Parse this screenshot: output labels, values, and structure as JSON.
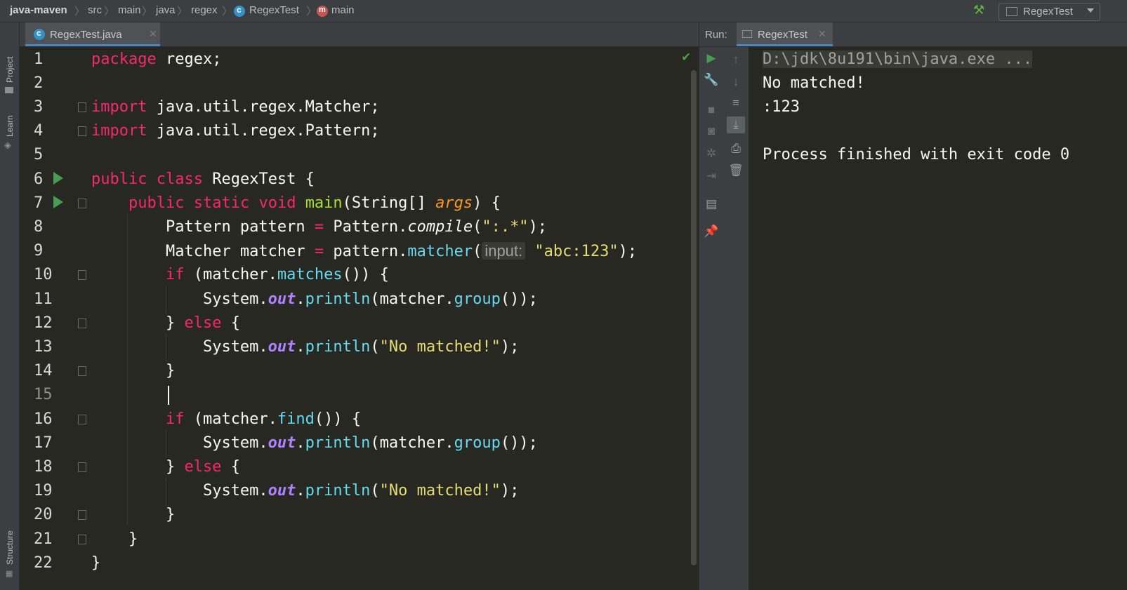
{
  "breadcrumb": {
    "project": "java-maven",
    "items": [
      "src",
      "main",
      "java",
      "regex",
      "RegexTest",
      "main"
    ]
  },
  "run_config": {
    "label": "RegexTest"
  },
  "left_strip": {
    "project_label": "Project",
    "learn_label": "Learn",
    "structure_label": "Structure"
  },
  "editor": {
    "tab_label": "RegexTest.java",
    "line_numbers": [
      "1",
      "2",
      "3",
      "4",
      "5",
      "6",
      "7",
      "8",
      "9",
      "10",
      "11",
      "12",
      "13",
      "14",
      "15",
      "16",
      "17",
      "18",
      "19",
      "20",
      "21",
      "22"
    ],
    "lines": {
      "l1": [
        [
          "kw",
          "package"
        ],
        [
          "",
          "regex;"
        ]
      ],
      "l3": [
        [
          "kw",
          "import"
        ],
        [
          "",
          "java.util.regex.Matcher;"
        ]
      ],
      "l4": [
        [
          "kw",
          "import"
        ],
        [
          "",
          "java.util.regex.Pattern;"
        ]
      ],
      "l6": [
        [
          "kw",
          "public"
        ],
        [
          "kw",
          "class"
        ],
        [
          "",
          "RegexTest {"
        ]
      ],
      "l7": [
        [
          "kw",
          "public"
        ],
        [
          "kw",
          "static"
        ],
        [
          "kw",
          "void"
        ],
        [
          "fn",
          "main"
        ],
        [
          "",
          "(String[] "
        ],
        [
          "param",
          "args"
        ],
        [
          "",
          ") {"
        ]
      ],
      "l8": [
        [
          "",
          "Pattern pattern "
        ],
        [
          "kw",
          "="
        ],
        [
          "",
          " Pattern."
        ],
        [
          "it",
          "compile"
        ],
        [
          "",
          "("
        ],
        [
          "str",
          "\":.*\""
        ],
        [
          "",
          ");"
        ]
      ],
      "l9": [
        [
          "",
          "Matcher matcher "
        ],
        [
          "kw",
          "="
        ],
        [
          "",
          " pattern."
        ],
        [
          "mth",
          "matcher"
        ],
        [
          "",
          "("
        ],
        [
          "hint",
          "input:"
        ],
        [
          "str",
          "\"abc:123\""
        ],
        [
          "",
          ");"
        ]
      ],
      "l10": [
        [
          "kw",
          "if"
        ],
        [
          "",
          " (matcher."
        ],
        [
          "mth",
          "matches"
        ],
        [
          "",
          "()) {"
        ]
      ],
      "l11": [
        [
          "",
          "System."
        ],
        [
          "out",
          "out"
        ],
        [
          "",
          "."
        ],
        [
          "mth",
          "println"
        ],
        [
          "",
          "(matcher."
        ],
        [
          "mth",
          "group"
        ],
        [
          "",
          "());"
        ]
      ],
      "l12": [
        [
          "",
          "} "
        ],
        [
          "kw",
          "else"
        ],
        [
          "",
          " {"
        ]
      ],
      "l13": [
        [
          "",
          "System."
        ],
        [
          "out",
          "out"
        ],
        [
          "",
          "."
        ],
        [
          "mth",
          "println"
        ],
        [
          "",
          "("
        ],
        [
          "str",
          "\"No matched!\""
        ],
        [
          "",
          ");"
        ]
      ],
      "l14": [
        [
          "",
          "}"
        ]
      ],
      "l16": [
        [
          "kw",
          "if"
        ],
        [
          "",
          " (matcher."
        ],
        [
          "mth",
          "find"
        ],
        [
          "",
          "()) {"
        ]
      ],
      "l17": [
        [
          "",
          "System."
        ],
        [
          "out",
          "out"
        ],
        [
          "",
          "."
        ],
        [
          "mth",
          "println"
        ],
        [
          "",
          "(matcher."
        ],
        [
          "mth",
          "group"
        ],
        [
          "",
          "());"
        ]
      ],
      "l18": [
        [
          "",
          "} "
        ],
        [
          "kw",
          "else"
        ],
        [
          "",
          " {"
        ]
      ],
      "l19": [
        [
          "",
          "System."
        ],
        [
          "out",
          "out"
        ],
        [
          "",
          "."
        ],
        [
          "mth",
          "println"
        ],
        [
          "",
          "("
        ],
        [
          "str",
          "\"No matched!\""
        ],
        [
          "",
          ");"
        ]
      ],
      "l20": [
        [
          "",
          "}"
        ]
      ],
      "l21": [
        [
          "",
          "}"
        ]
      ],
      "l22": [
        [
          "",
          "}"
        ]
      ]
    }
  },
  "run_panel": {
    "label": "Run:",
    "tab_label": "RegexTest",
    "console": {
      "command": "D:\\jdk\\8u191\\bin\\java.exe ...",
      "out1": "No matched!",
      "out2": ":123",
      "exit": "Process finished with exit code 0"
    }
  },
  "colors": {
    "keyword": "#f92672",
    "function": "#a6e22e",
    "method": "#66d9ef",
    "string": "#e6db74",
    "static_field": "#ae81ff",
    "parameter": "#fd971f",
    "background": "#272822"
  }
}
